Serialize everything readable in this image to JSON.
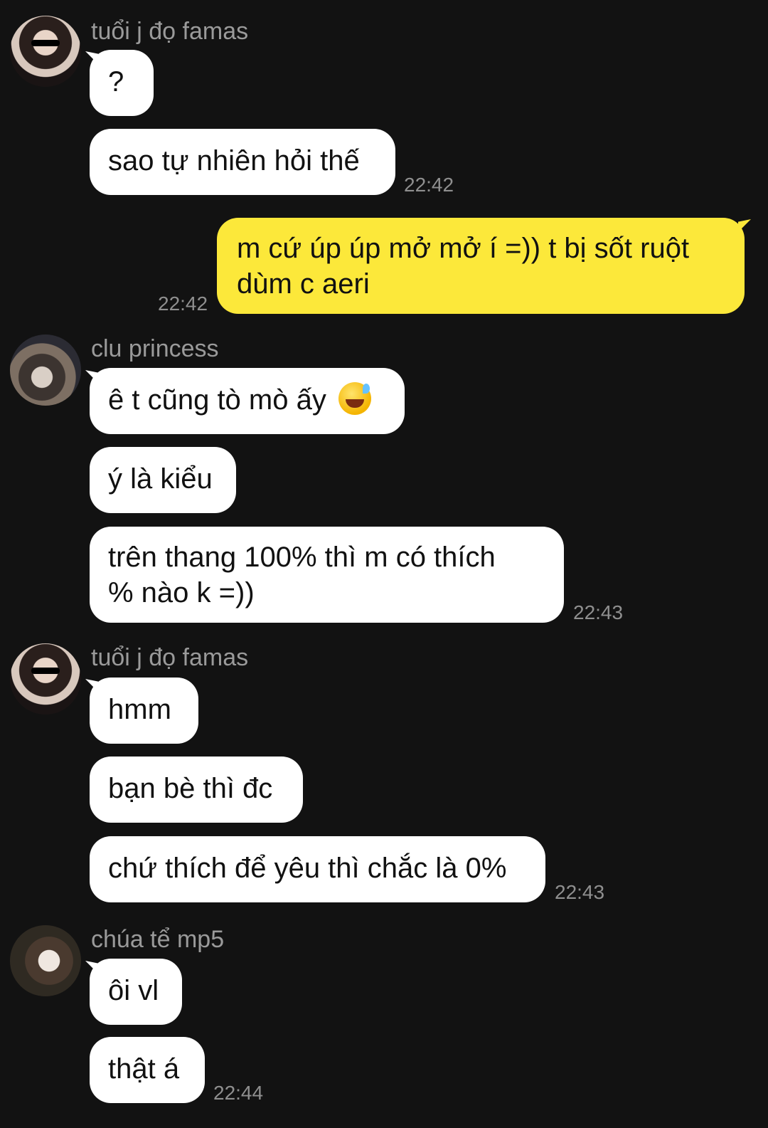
{
  "senders": {
    "s1": "tuổi j đọ famas",
    "s2": "clu princess",
    "s3": "tuổi j đọ famas",
    "s4": "chúa tể mp5"
  },
  "messages": {
    "m1": "?",
    "m2": "sao tự nhiên hỏi thế",
    "m3_line1": "m cứ úp úp mở mở í =)) t bị sốt ruột",
    "m3_line2": "dùm c aeri",
    "m4": "ê t cũng tò mò ấy",
    "m5": "ý là kiểu",
    "m6_line1": "trên thang 100% thì m có thích",
    "m6_line2": "% nào k =))",
    "m7": "hmm",
    "m8": "bạn bè thì đc",
    "m9": "chứ thích để yêu thì chắc là 0%",
    "m10": "ôi vl",
    "m11": "thật á"
  },
  "times": {
    "t1": "22:42",
    "t2": "22:42",
    "t3": "22:43",
    "t4": "22:43",
    "t5": "22:44"
  },
  "icons": {
    "emoji": "grinning-face-with-sweat-icon"
  }
}
